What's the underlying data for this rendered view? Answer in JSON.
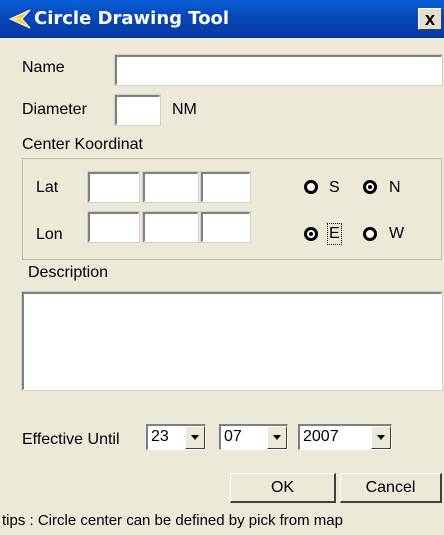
{
  "window": {
    "title": "Circle Drawing Tool",
    "close_glyph": "x"
  },
  "form": {
    "name_label": "Name",
    "name_value": "",
    "diameter_label": "Diameter",
    "diameter_value": "",
    "diameter_unit": "NM",
    "center_label": "Center Koordinat",
    "lat_label": "Lat",
    "lon_label": "Lon",
    "lat_hemisphere": {
      "options": [
        "S",
        "N"
      ],
      "selected": "N"
    },
    "lon_hemisphere": {
      "options": [
        "E",
        "W"
      ],
      "selected": "E"
    },
    "description_label": "Description",
    "description_value": "",
    "effective_label": "Effective Until",
    "effective_day": "23",
    "effective_month": "07",
    "effective_year": "2007"
  },
  "buttons": {
    "ok": "OK",
    "cancel": "Cancel"
  },
  "tips": "tips : Circle center can be defined by pick from map",
  "icons": {
    "title": "plane-icon"
  },
  "colors": {
    "titlebar": "#0a5fd8",
    "background": "#ece9d8"
  }
}
